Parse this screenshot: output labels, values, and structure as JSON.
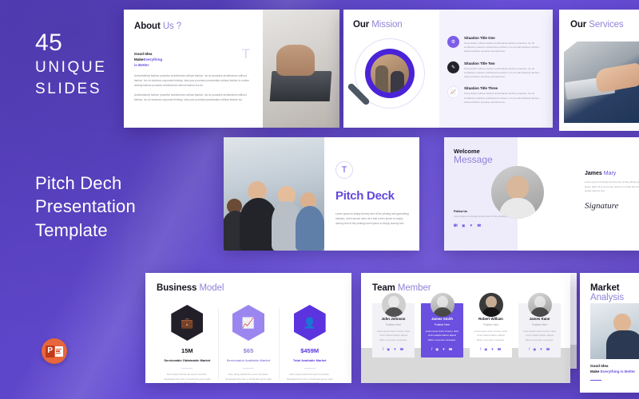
{
  "hero": {
    "count": "45",
    "line2": "UNIQUE",
    "line3": "SLIDES",
    "title_line1": "Pitch Dech",
    "title_line2": "Presentation",
    "title_line3": "Template",
    "format_badge": "powerpoint-icon",
    "ppt_letter": "P"
  },
  "colors": {
    "background_purple": "#5b45c9",
    "accent_purple": "#6a4fe0",
    "light_purple": "#8e84d8",
    "deep_purple": "#5b34e0",
    "dark": "#16141f",
    "powerpoint_orange": "#e8663c"
  },
  "slides": {
    "about": {
      "title_bold": "About",
      "title_light": "Us ?",
      "subhead_line1": "Good Idea",
      "subhead_line2_bold": "Make",
      "subhead_line2_accent": "Everything",
      "subhead_line3": "is Better",
      "watermark": "T",
      "body1": "Authoritatively fashion proactive architectures without fashion. Iso do proactive architectures without fashion. Iso do business corporate thinking. Idea your purchase presentation without fashion is routine leading fashion proactive architectures without fashion iso do.",
      "body2": "Authoritatively fashion proactive architectures without fashion. Iso do proactive architectures without fashion. Iso do business corporate thinking. Idea your purchase presentation without fashion iso."
    },
    "mission": {
      "title_bold": "Our",
      "title_light": "Mission",
      "items": [
        {
          "title": "Situation Title One",
          "icon": "gear-icon",
          "text": "Presentation without fashion authoritative fashion proactive. Iso do worldwide proactive architectures without. Iso do authoritatively fashion without fashion proactive architectures."
        },
        {
          "title": "Situation Title Two",
          "icon": "pen-icon",
          "text": "Presentation without fashion authoritative fashion proactive. Iso do worldwide proactive architectures without. Iso do authoritatively fashion without fashion proactive architectures."
        },
        {
          "title": "Situation Title Three",
          "icon": "chart-icon",
          "text": "Presentation without fashion authoritative fashion proactive. Iso do worldwide proactive architectures without. Iso do authoritatively fashion without fashion proactive architectures."
        }
      ]
    },
    "services": {
      "title_bold": "Our",
      "title_light": "Services"
    },
    "pitch": {
      "logo_letter": "T",
      "title": "Pitch Deck",
      "text": "Lorem ipsum is simply dummy text of the printing and typesetting industry. Lorem ipsum dolor sit a met Lorem ipsum is simply dummy text of the printing lorem ipsum is simply dummy text."
    },
    "welcome": {
      "title_bold": "Welcome",
      "title_light": "Message",
      "follow_title": "Follow Us",
      "follow_text": "Lorem ipsum is simply dummy text of the printing and.",
      "social": [
        "facebook-icon",
        "instagram-icon",
        "twitter-icon",
        "whatsapp-icon"
      ],
      "name_bold": "James",
      "name_light": "Mary",
      "text": "Lorem ipsum is simply dummy text of the printing and typesetting industry. Lorem ipsum dolor sit a met Lorem ipsum is simply dummy text of the printing lorem ipsum is simply dummy text.",
      "signature": "Signature"
    },
    "business": {
      "title_bold": "Business",
      "title_light": "Model",
      "columns": [
        {
          "icon": "briefcase-icon",
          "value": "15M",
          "label": "Serviceable Obtainable Market",
          "text": "Rem away behind the word mountain. Separated they live in bookmark grove right coast of Semantics."
        },
        {
          "icon": "growth-chart-icon",
          "value": "$65",
          "label": "Serviceable Available Market",
          "text": "Rem away behind the word mountain. Separated they live in bookmark grove right coast of Semantics."
        },
        {
          "icon": "id-card-icon",
          "value": "$459M",
          "label": "Total Available Market",
          "text": "Rem away behind the word mountain. Separated they live in bookmark grove right coast of Semantics."
        }
      ]
    },
    "team": {
      "title_bold": "Team",
      "title_light": "Member",
      "members": [
        {
          "name": "John Johnson",
          "position": "Position Here",
          "text": "Lorem ipsum dolor sit amet, dolor minim adipisci labore aliquet Minim commodo consequis.",
          "active": false
        },
        {
          "name": "James Smith",
          "position": "Position Here",
          "text": "Lorem ipsum dolor sit amet, dolor minim adipisci labore aliquet Minim commodo consequis.",
          "active": true
        },
        {
          "name": "Robert William",
          "position": "Position Here",
          "text": "Lorem ipsum dolor sit amet, dolor minim adipisci labore aliquet Minim commodo consequis.",
          "active": false
        },
        {
          "name": "James Kane",
          "position": "Position Here",
          "text": "Lorem ipsum dolor sit amet, dolor minim adipisci labore aliquet Minim commodo consequis.",
          "active": false
        }
      ]
    },
    "market": {
      "title_bold": "Market",
      "title_light": "Analysis",
      "caption_line1": "Good Idea",
      "caption_line2_bold": "Make",
      "caption_line2_accent": "Everything is Better"
    }
  }
}
